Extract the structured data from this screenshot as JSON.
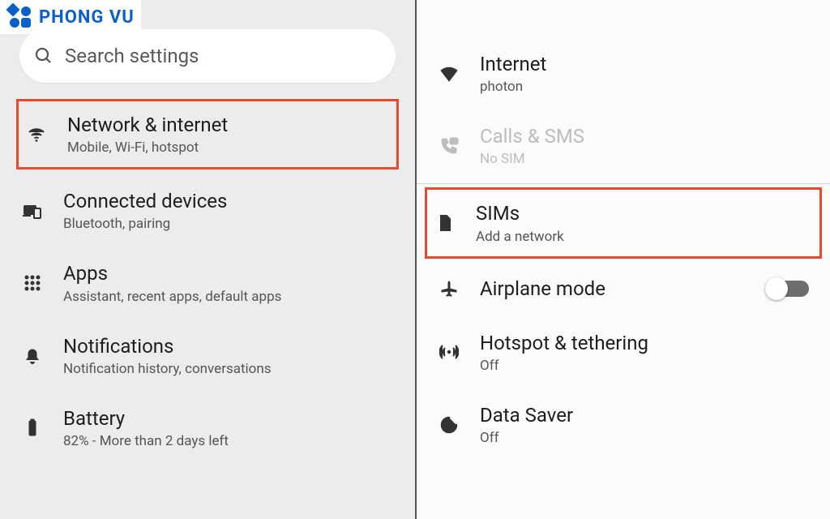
{
  "logo": {
    "text": "PHONG VU"
  },
  "search": {
    "placeholder": "Search settings"
  },
  "left": {
    "items": [
      {
        "title": "Network & internet",
        "subtitle": "Mobile, Wi-Fi, hotspot"
      },
      {
        "title": "Connected devices",
        "subtitle": "Bluetooth, pairing"
      },
      {
        "title": "Apps",
        "subtitle": "Assistant, recent apps, default apps"
      },
      {
        "title": "Notifications",
        "subtitle": "Notification history, conversations"
      },
      {
        "title": "Battery",
        "subtitle": "82% - More than 2 days left"
      }
    ]
  },
  "right": {
    "items": [
      {
        "title": "Internet",
        "subtitle": "photon"
      },
      {
        "title": "Calls & SMS",
        "subtitle": "No SIM"
      },
      {
        "title": "SIMs",
        "subtitle": "Add a network"
      },
      {
        "title": "Airplane mode"
      },
      {
        "title": "Hotspot & tethering",
        "subtitle": "Off"
      },
      {
        "title": "Data Saver",
        "subtitle": "Off"
      }
    ]
  },
  "colors": {
    "highlight": "#e84a2f",
    "brand": "#0a60c9"
  }
}
